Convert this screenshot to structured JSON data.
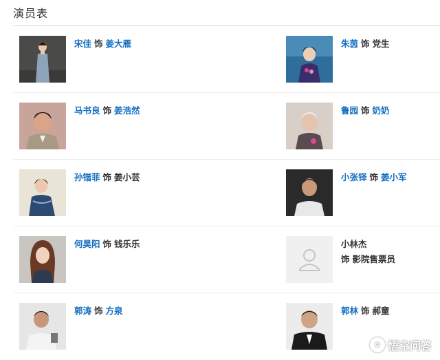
{
  "page": {
    "title": "演员表"
  },
  "cast": [
    {
      "actor": "宋佳",
      "as": "饰",
      "role": "姜大雁",
      "role_linked": true,
      "photo": "actress-photo-icon"
    },
    {
      "actor": "朱茵",
      "as": "饰",
      "role": "党生",
      "role_linked": false,
      "photo": "actress-photo-icon"
    },
    {
      "actor": "马书良",
      "as": "饰",
      "role": "姜浩然",
      "role_linked": true,
      "photo": "actor-photo-icon"
    },
    {
      "actor": "鲁园",
      "as": "饰",
      "role": "奶奶",
      "role_linked": true,
      "photo": "actress-photo-icon"
    },
    {
      "actor": "孙锴菲",
      "as": "饰",
      "role": "姜小芸",
      "role_linked": false,
      "photo": "actress-photo-icon"
    },
    {
      "actor": "小张铎",
      "as": "饰",
      "role": "姜小军",
      "role_linked": true,
      "photo": "actor-photo-icon"
    },
    {
      "actor": "何昊阳",
      "as": "饰",
      "role": "钱乐乐",
      "role_linked": false,
      "photo": "actress-photo-icon"
    },
    {
      "actor": "小林杰",
      "as": "饰",
      "role": "影院售票员",
      "role_linked": false,
      "photo": "default-avatar-icon"
    },
    {
      "actor": "郭涛",
      "as": "饰",
      "role": "方泉",
      "role_linked": true,
      "photo": "actor-photo-icon"
    },
    {
      "actor": "郭林",
      "as": "饰",
      "role": "郝童",
      "role_linked": false,
      "photo": "actor-photo-icon"
    }
  ],
  "watermark": {
    "text": "悟空问答"
  },
  "colors": {
    "link": "#136ec2",
    "text": "#333333",
    "divider": "#ececec"
  }
}
